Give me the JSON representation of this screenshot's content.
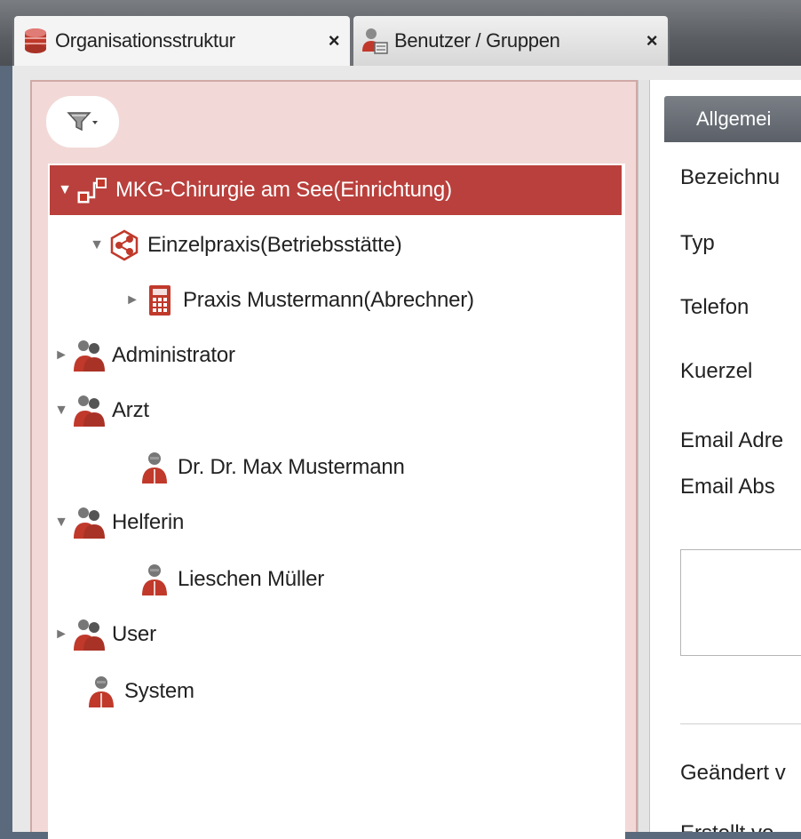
{
  "tabs": [
    {
      "label": "Organisationsstruktur",
      "icon": "database-icon",
      "close": "×"
    },
    {
      "label": "Benutzer / Gruppen",
      "icon": "users-icon",
      "close": "×"
    }
  ],
  "tree": {
    "filter_icon": "filter-funnel-icon",
    "nodes": [
      {
        "label": "MKG-Chirurgie am See(Einrichtung)",
        "icon": "hierarchy-icon",
        "arrow": "▼",
        "selected": true
      },
      {
        "label": "Einzelpraxis(Betriebsstätte)",
        "icon": "network-icon",
        "arrow": "▼"
      },
      {
        "label": "Praxis Mustermann(Abrechner)",
        "icon": "calculator-icon",
        "arrow": "►"
      },
      {
        "label": "Administrator",
        "icon": "user-group-icon",
        "arrow": "►"
      },
      {
        "label": "Arzt",
        "icon": "user-group-icon",
        "arrow": "▼"
      },
      {
        "label": "Dr. Dr. Max Mustermann",
        "icon": "user-icon",
        "arrow": ""
      },
      {
        "label": "Helferin",
        "icon": "user-group-icon",
        "arrow": "▼"
      },
      {
        "label": "Lieschen Müller",
        "icon": "user-icon",
        "arrow": ""
      },
      {
        "label": "User",
        "icon": "user-group-icon",
        "arrow": "►"
      },
      {
        "label": "System",
        "icon": "user-icon",
        "arrow": ""
      }
    ]
  },
  "detail": {
    "tab_label": "Allgemei",
    "fields": [
      "Bezeichnu",
      "Typ",
      "Telefon",
      "Kuerzel",
      "Email Adre",
      "Email Abs"
    ],
    "changed_label": "Geändert v",
    "created_label": "Erstellt vo"
  },
  "colors": {
    "selected_row": "#b9403c",
    "panel_bg": "#f2d9d7",
    "icon_red": "#c0392b"
  }
}
